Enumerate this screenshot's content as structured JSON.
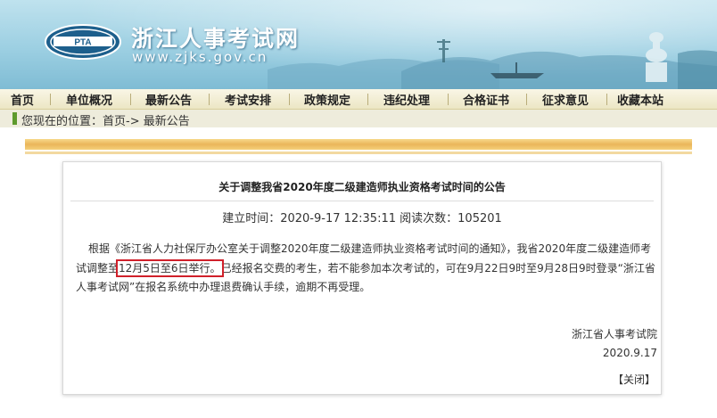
{
  "header": {
    "site_title": "浙江人事考试网",
    "site_url": "www.zjks.gov.cn",
    "logo_text": "PTA"
  },
  "nav": {
    "items": [
      "首页",
      "单位概况",
      "最新公告",
      "考试安排",
      "政策规定",
      "违纪处理",
      "合格证书",
      "征求意见",
      "收藏本站"
    ]
  },
  "breadcrumb": {
    "prefix": "您现在的位置：",
    "home": "首页",
    "arrow": "->",
    "current": "最新公告"
  },
  "article": {
    "title": "关于调整我省2020年度二级建造师执业资格考试时间的公告",
    "meta_label": "建立时间：",
    "created": "2020-9-17 12:35:11",
    "views_label": "阅读次数：",
    "views": "105201",
    "para_part1": "根据《浙江省人力社保厅办公室关于调整2020年度二级建造师执业资格考试时间的通知》，我省2020年度二级建造师考试调整至",
    "para_highlight": "12月5日至6日举行。",
    "para_part2": "已经报名交费的考生，若不能参加本次考试的，可在9月22日9时至9月28日9时登录“浙江省人事考试网”在报名系统中办理退费确认手续，逾期不再受理。",
    "signature_org": "浙江省人事考试院",
    "signature_date": "2020.9.17",
    "close_label": "【关闭】"
  },
  "colors": {
    "header_sky": "#9ccfe2",
    "nav_bg": "#ece6c4",
    "crumb_bg": "#eeecdc",
    "crumb_marker": "#5e9a2c",
    "gold_strip": "#eab55a",
    "highlight_border": "#d0202a"
  }
}
